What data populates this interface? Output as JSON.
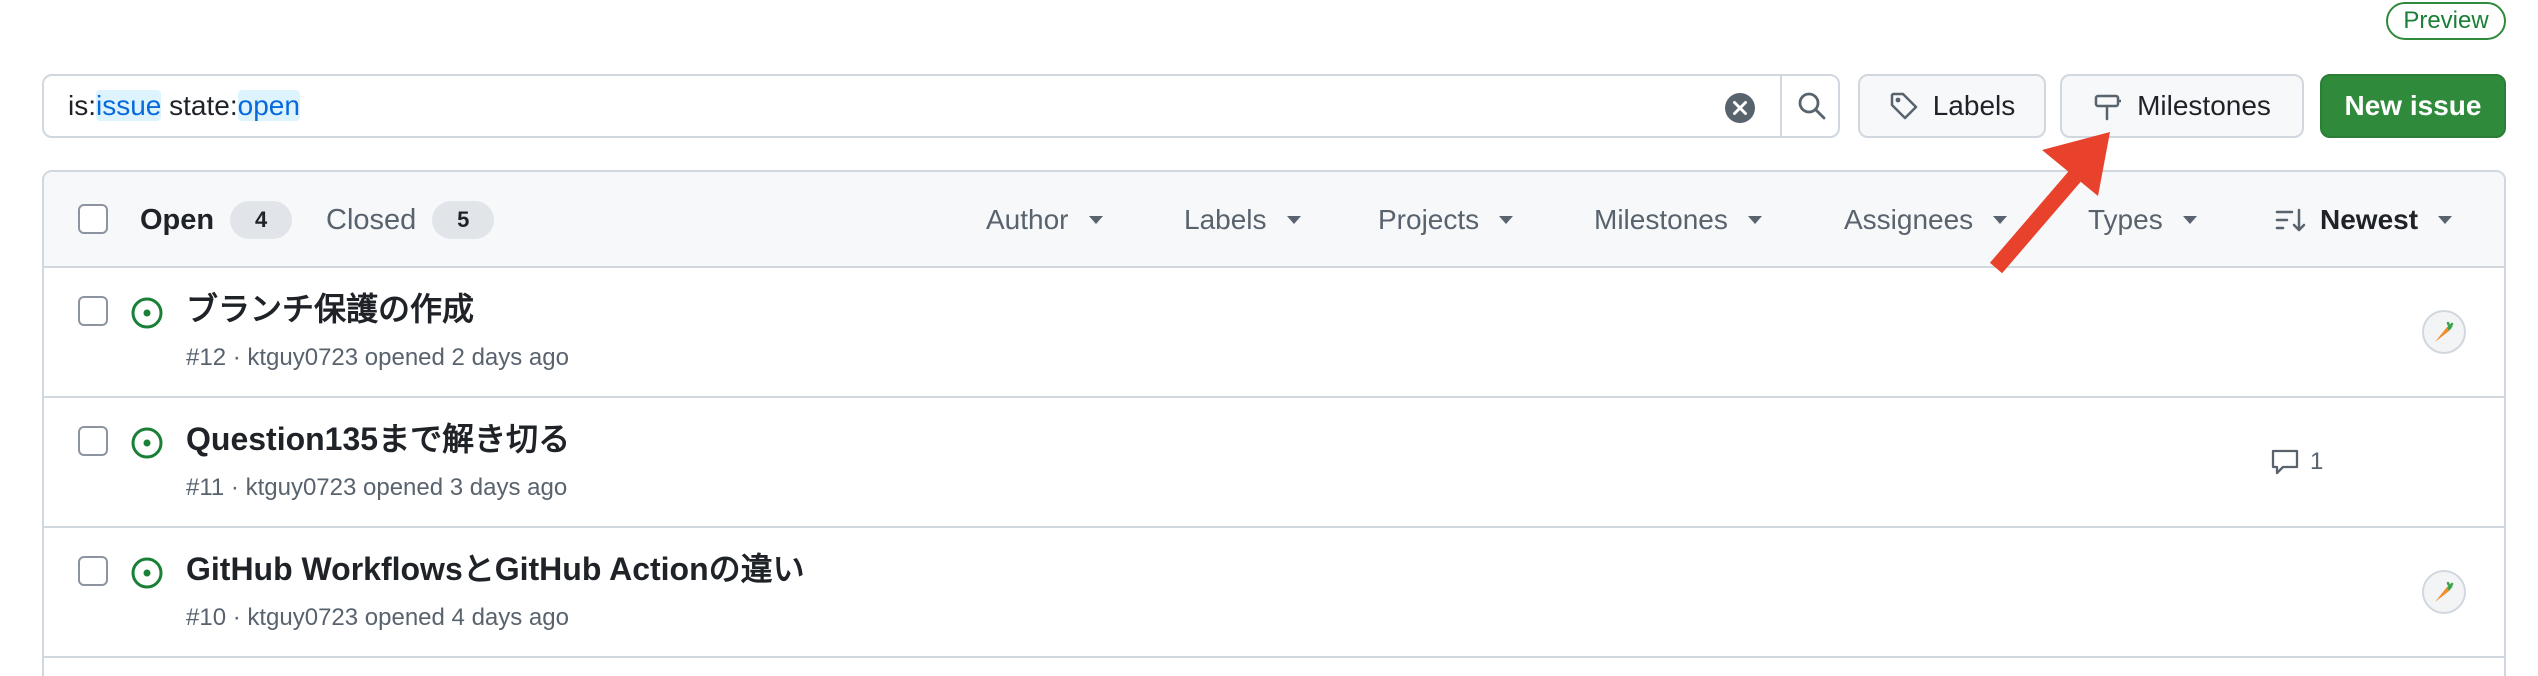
{
  "preview_badge": "Preview",
  "search": {
    "prefix1": "is:",
    "kw1": "issue",
    "prefix2": " state:",
    "kw2": "open"
  },
  "toolbar": {
    "labels_label": "Labels",
    "milestones_label": "Milestones",
    "new_issue_label": "New issue"
  },
  "header": {
    "open_label": "Open",
    "open_count": "4",
    "closed_label": "Closed",
    "closed_count": "5",
    "filters": [
      "Author",
      "Labels",
      "Projects",
      "Milestones",
      "Assignees",
      "Types"
    ],
    "sort_label": "Newest"
  },
  "issues": [
    {
      "title": "ブランチ保護の作成",
      "meta": "#12 · ktguy0723 opened 2 days ago",
      "comments": "",
      "has_avatar": true
    },
    {
      "title": "Question135まで解き切る",
      "meta": "#11 · ktguy0723 opened 3 days ago",
      "comments": "1",
      "has_avatar": false
    },
    {
      "title": "GitHub WorkflowsとGitHub Actionの違い",
      "meta": "#10 · ktguy0723 opened 4 days ago",
      "comments": "",
      "has_avatar": true
    }
  ],
  "colors": {
    "accent_green": "#2f8a3c",
    "link_blue": "#0969da",
    "annotation_arrow": "#e8412c"
  },
  "icons": [
    "clear-icon",
    "search-icon",
    "tag-icon",
    "milestone-icon",
    "issue-open-icon",
    "comment-icon",
    "sort-icon",
    "caret-down-icon",
    "carrot-avatar-icon"
  ]
}
